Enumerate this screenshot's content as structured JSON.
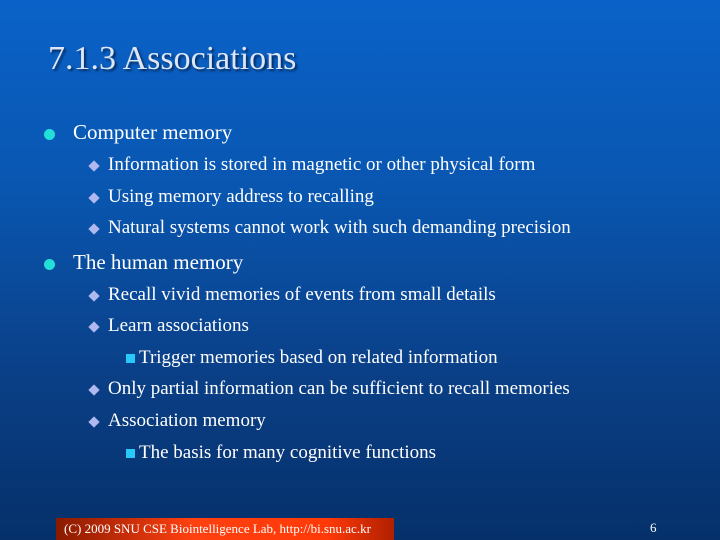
{
  "title": "7.1.3 Associations",
  "sections": [
    {
      "label": "Computer memory",
      "items": [
        "Information is stored in magnetic or other physical form",
        "Using memory address to recalling",
        "Natural systems cannot work with such demanding precision"
      ]
    },
    {
      "label": "The human memory",
      "items": [
        "Recall vivid memories of events from small details",
        "Learn associations",
        "Trigger memories based on related information",
        "Only partial information can be sufficient to recall memories",
        "Association memory",
        "The basis for many cognitive functions"
      ]
    }
  ],
  "footer": "(C) 2009 SNU CSE Biointelligence Lab,   http://bi.snu.ac.kr",
  "page_number": "6"
}
